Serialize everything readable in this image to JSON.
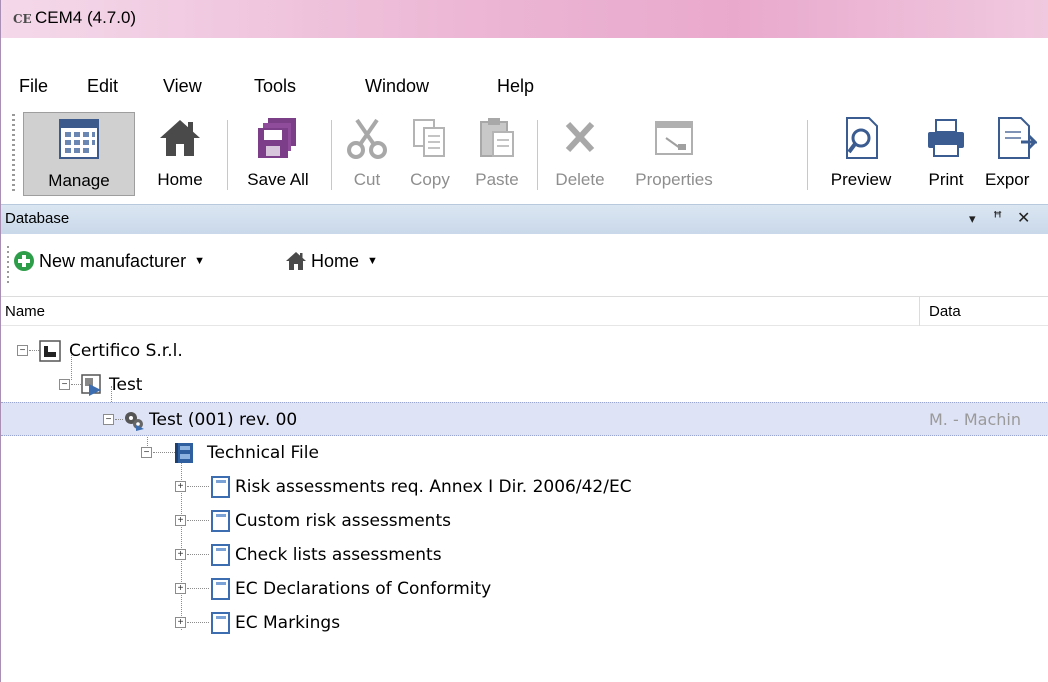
{
  "window": {
    "title": "CEM4 (4.7.0)",
    "app_icon_text": "CE"
  },
  "menu": [
    "File",
    "Edit",
    "View",
    "Tools",
    "Window",
    "Help"
  ],
  "toolbar": {
    "manage": "Manage",
    "home": "Home",
    "save_all": "Save All",
    "cut": "Cut",
    "copy": "Copy",
    "paste": "Paste",
    "delete": "Delete",
    "properties": "Properties",
    "preview": "Preview",
    "print": "Print",
    "export": "Expor"
  },
  "panel": {
    "title": "Database",
    "controls": {
      "dropdown": "▾",
      "pin": "ꟸ",
      "close": "✕"
    }
  },
  "subtoolbar": {
    "new_manufacturer": "New manufacturer",
    "home": "Home"
  },
  "columns": {
    "name": "Name",
    "data": "Data"
  },
  "tree": [
    {
      "label": "Certifico S.r.l.",
      "data": ""
    },
    {
      "label": "Test",
      "data": ""
    },
    {
      "label": "Test (001) rev. 00",
      "data": "M. - Machin"
    },
    {
      "label": "Technical File",
      "data": ""
    },
    {
      "label": "Risk assessments req. Annex I Dir. 2006/42/EC",
      "data": ""
    },
    {
      "label": "Custom risk assessments",
      "data": ""
    },
    {
      "label": "Check lists assessments",
      "data": ""
    },
    {
      "label": "EC Declarations of Conformity",
      "data": ""
    },
    {
      "label": "EC Markings",
      "data": ""
    }
  ],
  "colors": {
    "title_bar": "#e9a9cd",
    "panel_header": "#c9d8ea",
    "selection": "#dfe3f6"
  }
}
